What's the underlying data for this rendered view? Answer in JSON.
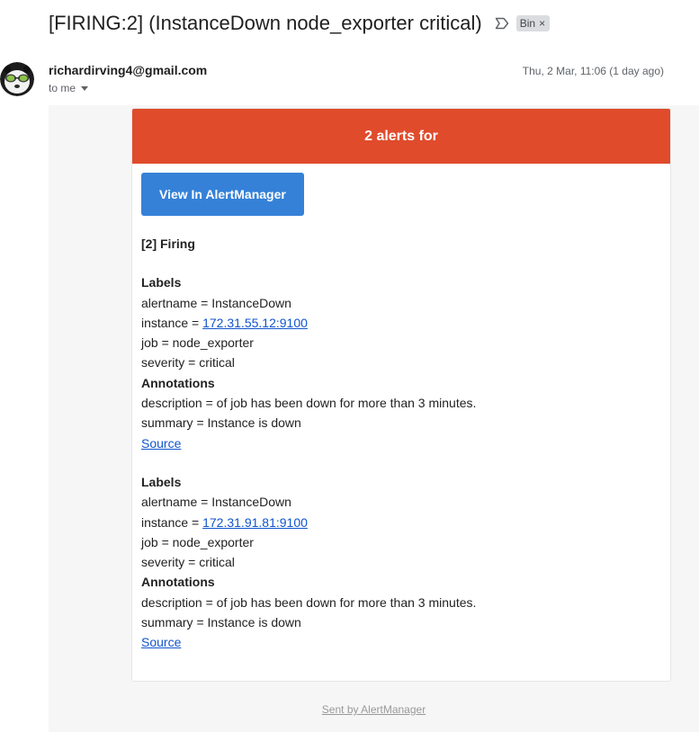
{
  "email": {
    "subject": "[FIRING:2] (InstanceDown node_exporter critical)",
    "label_chip": "Bin",
    "label_chip_close": "×",
    "sender": "richardirving4@gmail.com",
    "recipient": "to me",
    "date": "Thu, 2 Mar, 11:06 (1 day ago)"
  },
  "alert": {
    "header": "2 alerts for",
    "button_label": "View In AlertManager",
    "firing_title": "[2] Firing",
    "labels_heading": "Labels",
    "annotations_heading": "Annotations",
    "source_label": "Source",
    "alerts": [
      {
        "alertname": "alertname = InstanceDown",
        "instance_prefix": "instance = ",
        "instance": "172.31.55.12:9100",
        "job": "job = node_exporter",
        "severity": "severity = critical",
        "description": "description = of job has been down for more than 3 minutes.",
        "summary": "summary = Instance is down"
      },
      {
        "alertname": "alertname = InstanceDown",
        "instance_prefix": "instance = ",
        "instance": "172.31.91.81:9100",
        "job": "job = node_exporter",
        "severity": "severity = critical",
        "description": "description = of job has been down for more than 3 minutes.",
        "summary": "summary = Instance is down"
      }
    ],
    "footer": "Sent by AlertManager"
  },
  "colors": {
    "header_red": "#e04b2c",
    "button_blue": "#3581d8",
    "link_blue": "#1155cc"
  },
  "icons": {
    "label": "label-outline-icon",
    "avatar": "panda-avatar"
  }
}
